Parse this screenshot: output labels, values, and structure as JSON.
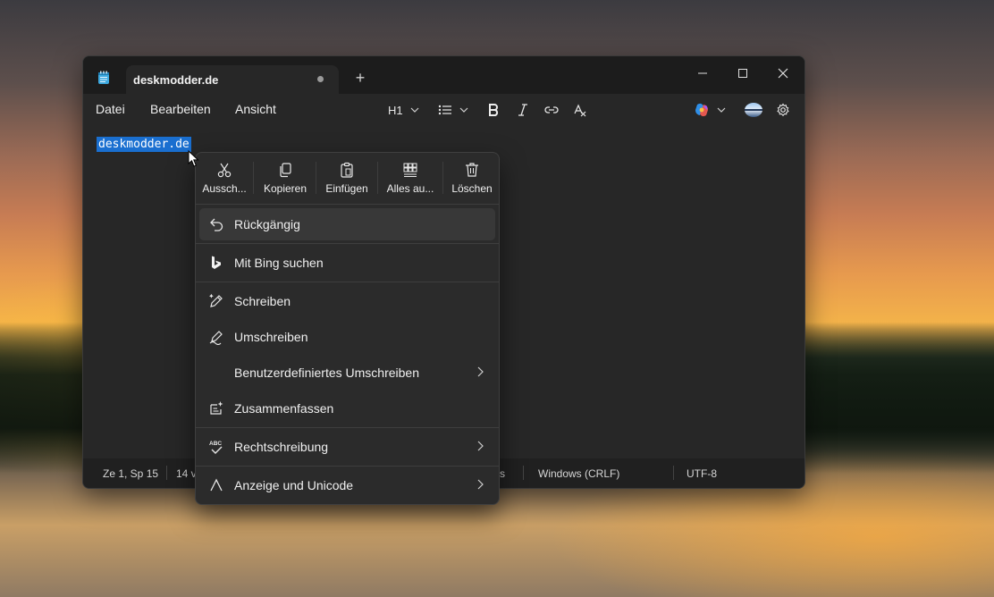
{
  "window": {
    "tab_title": "deskmodder.de",
    "new_tab": "+"
  },
  "menu": {
    "file": "Datei",
    "edit": "Bearbeiten",
    "view": "Ansicht"
  },
  "toolbar": {
    "heading": "H1"
  },
  "editor": {
    "content": "deskmodder.de"
  },
  "status": {
    "position": "Ze 1, Sp 15",
    "chars": "14 v",
    "partial": "s",
    "line_ending": "Windows (CRLF)",
    "encoding": "UTF-8"
  },
  "context_menu": {
    "quick": {
      "cut": "Aussch...",
      "copy": "Kopieren",
      "paste": "Einfügen",
      "select_all": "Alles au...",
      "delete": "Löschen"
    },
    "items": {
      "undo": "Rückgängig",
      "bing": "Mit Bing suchen",
      "write": "Schreiben",
      "rewrite": "Umschreiben",
      "custom_rewrite": "Benutzerdefiniertes Umschreiben",
      "summarize": "Zusammenfassen",
      "spelling": "Rechtschreibung",
      "unicode": "Anzeige und Unicode"
    }
  },
  "colors": {
    "selection": "#1a6fd0",
    "window_bg": "#272727",
    "titlebar_bg": "#1c1c1c"
  }
}
